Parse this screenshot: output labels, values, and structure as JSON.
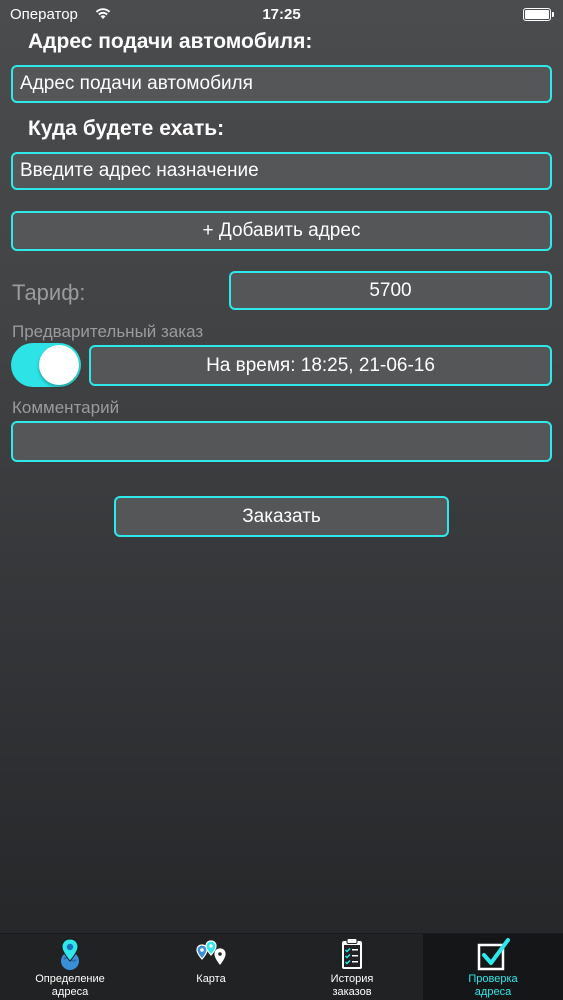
{
  "status_bar": {
    "carrier": "Оператор",
    "time": "17:25"
  },
  "form": {
    "pickup_heading": "Адрес подачи автомобиля:",
    "pickup_placeholder": "Адрес подачи автомобиля",
    "destination_heading": "Куда будете ехать:",
    "destination_placeholder": "Введите адрес назначение",
    "add_address_label": "+ Добавить адрес",
    "tariff_label": "Тариф:",
    "tariff_value": "5700",
    "preorder_label": "Предварительный заказ",
    "preorder_enabled": true,
    "preorder_time": "На время: 18:25, 21-06-16",
    "comment_label": "Комментарий",
    "comment_value": "",
    "order_button_label": "Заказать"
  },
  "colors": {
    "accent": "#2ee8ea",
    "field_bg": "#555658",
    "tabbar_bg": "#202223"
  },
  "tab_bar": {
    "tabs": [
      {
        "label": "Определение\nадреса",
        "icon": "globe-pin-icon",
        "active": false
      },
      {
        "label": "Карта",
        "icon": "map-pins-icon",
        "active": false
      },
      {
        "label": "История\nзаказов",
        "icon": "clipboard-checklist-icon",
        "active": false
      },
      {
        "label": "Проверка\nадреса",
        "icon": "checkbox-icon",
        "active": true
      }
    ]
  }
}
